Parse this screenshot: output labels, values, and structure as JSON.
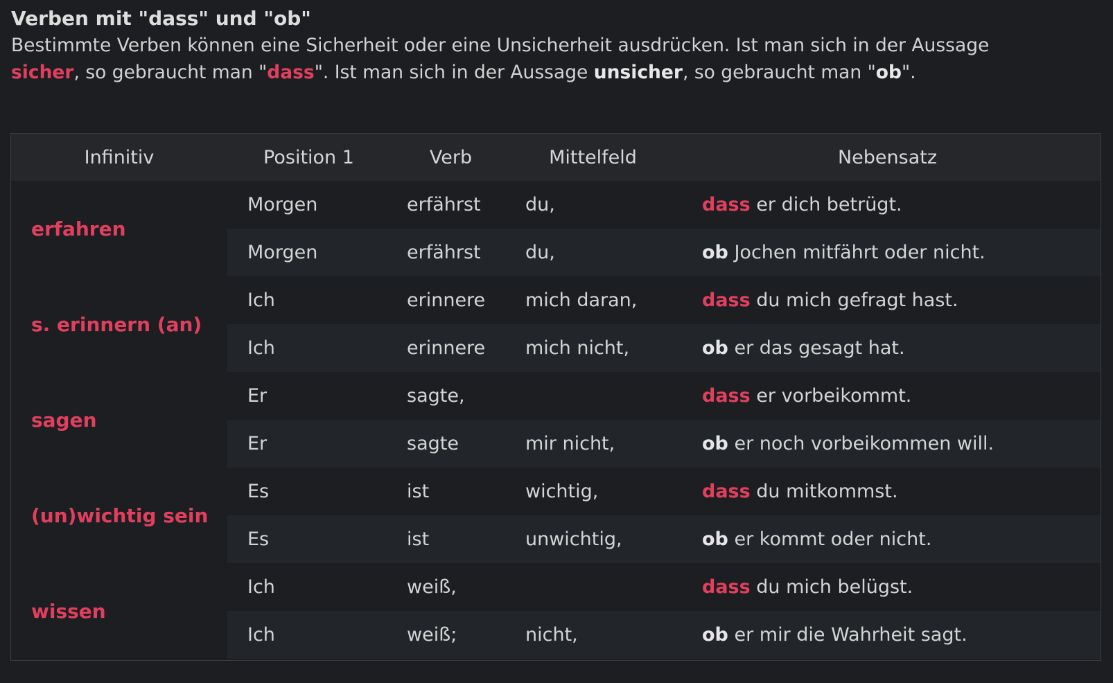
{
  "heading": {
    "title": "Verben mit \"dass\" und \"ob\"",
    "line1": "Bestimmte Verben können eine Sicherheit oder eine Unsicherheit ausdrücken. Ist man sich in der Aussage",
    "word_sicher": "sicher",
    "part_a": ", so gebraucht man \"",
    "word_dass": "dass",
    "part_b": "\". Ist man sich in der Aussage ",
    "word_unsicher": "unsicher",
    "part_c": ", so gebraucht man \"",
    "word_ob": "ob",
    "part_d": "\"."
  },
  "table": {
    "headers": [
      "Infinitiv",
      "Position 1",
      "Verb",
      "Mittelfeld",
      "Nebensatz"
    ],
    "groups": [
      {
        "infinitiv": "erfahren",
        "rows": [
          {
            "pos": "Morgen",
            "verb": "erfährst",
            "mit": "du,",
            "kw": "dass",
            "rest": " er dich betrügt."
          },
          {
            "pos": "Morgen",
            "verb": "erfährst",
            "mit": "du,",
            "kw": "ob",
            "rest": " Jochen mitfährt oder nicht."
          }
        ]
      },
      {
        "infinitiv": "s. erinnern (an)",
        "rows": [
          {
            "pos": "Ich",
            "verb": "erinnere",
            "mit": "mich daran,",
            "kw": "dass",
            "rest": " du mich gefragt hast."
          },
          {
            "pos": "Ich",
            "verb": "erinnere",
            "mit": "mich nicht,",
            "kw": "ob",
            "rest": " er das gesagt hat."
          }
        ]
      },
      {
        "infinitiv": "sagen",
        "rows": [
          {
            "pos": "Er",
            "verb": "sagte,",
            "mit": "",
            "kw": "dass",
            "rest": " er vorbeikommt."
          },
          {
            "pos": "Er",
            "verb": "sagte",
            "mit": "mir nicht,",
            "kw": "ob",
            "rest": " er noch vorbeikommen will."
          }
        ]
      },
      {
        "infinitiv": "(un)wichtig sein",
        "rows": [
          {
            "pos": "Es",
            "verb": "ist",
            "mit": "wichtig,",
            "kw": "dass",
            "rest": " du mitkommst."
          },
          {
            "pos": "Es",
            "verb": "ist",
            "mit": "unwichtig,",
            "kw": "ob",
            "rest": " er kommt oder nicht."
          }
        ]
      },
      {
        "infinitiv": "wissen",
        "rows": [
          {
            "pos": "Ich",
            "verb": "weiß,",
            "mit": "",
            "kw": "dass",
            "rest": " du mich belügst."
          },
          {
            "pos": "Ich",
            "verb": "weiß;",
            "mit": "nicht,",
            "kw": "ob",
            "rest": " er mir die Wahrheit sagt."
          }
        ]
      }
    ]
  }
}
